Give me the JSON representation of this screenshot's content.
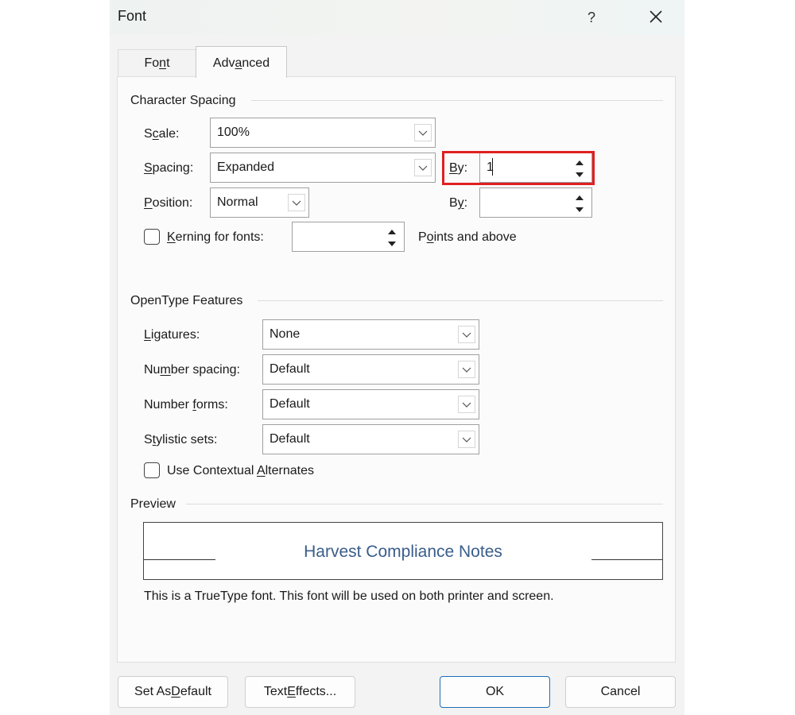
{
  "window": {
    "title": "Font",
    "help_label": "?",
    "close_icon": "close-icon"
  },
  "tabs": [
    {
      "label_pre": "Fo",
      "label_ul": "n",
      "label_post": "t",
      "active": false
    },
    {
      "label_pre": "Adv",
      "label_ul": "a",
      "label_post": "nced",
      "active": true
    }
  ],
  "character_spacing": {
    "title": "Character Spacing",
    "scale": {
      "label_pre": "S",
      "label_ul": "c",
      "label_post": "ale:",
      "value": "100%"
    },
    "spacing": {
      "label_pre": "",
      "label_ul": "S",
      "label_post": "pacing:",
      "value": "Expanded",
      "by_label_ul": "B",
      "by_label_post": "y:",
      "by_value": "1"
    },
    "position": {
      "label_pre": "",
      "label_ul": "P",
      "label_post": "osition:",
      "value": "Normal",
      "by_label_pre": "B",
      "by_label_ul": "y",
      "by_label_post": ":",
      "by_value": ""
    },
    "kerning": {
      "label_ul": "K",
      "label_post": "erning for fonts:",
      "checked": false,
      "value": "",
      "suffix_pre": "P",
      "suffix_ul": "o",
      "suffix_post": "ints and above"
    }
  },
  "opentype": {
    "title": "OpenType Features",
    "ligatures": {
      "label_ul": "L",
      "label_post": "igatures:",
      "value": "None"
    },
    "number_spacing": {
      "label_pre": "Nu",
      "label_ul": "m",
      "label_post": "ber spacing:",
      "value": "Default"
    },
    "number_forms": {
      "label_pre": "Number ",
      "label_ul": "f",
      "label_post": "orms:",
      "value": "Default"
    },
    "stylistic_sets": {
      "label_pre": "S",
      "label_ul": "t",
      "label_post": "ylistic sets:",
      "value": "Default"
    },
    "contextual": {
      "label_pre": "Use Contextual ",
      "label_ul": "A",
      "label_post": "lternates",
      "checked": false
    }
  },
  "preview": {
    "title": "Preview",
    "sample_text": "Harvest Compliance Notes",
    "sample_color": "#3a5d8a",
    "note": "This is a TrueType font. This font will be used on both printer and screen."
  },
  "buttons": {
    "set_default_pre": "Set As ",
    "set_default_ul": "D",
    "set_default_post": "efault",
    "text_effects_pre": "Text ",
    "text_effects_ul": "E",
    "text_effects_post": "ffects...",
    "ok": "OK",
    "cancel": "Cancel"
  },
  "highlight_color": "#e02020"
}
